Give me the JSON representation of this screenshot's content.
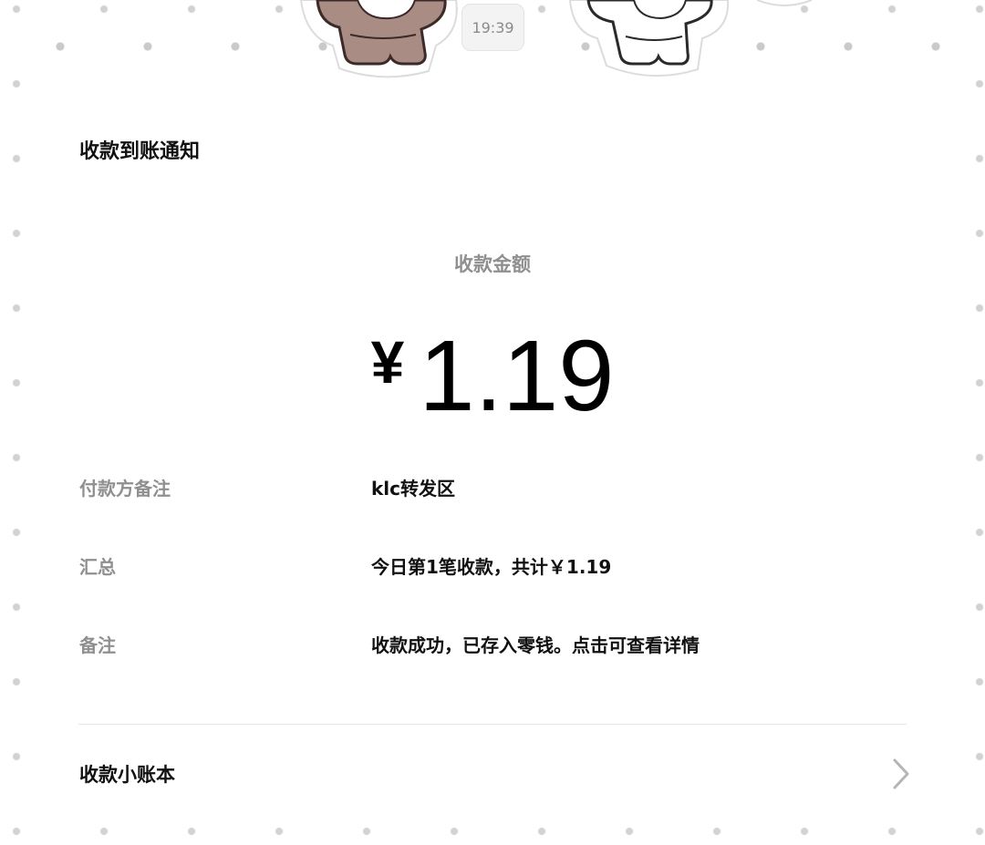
{
  "chat": {
    "timestamp": "19:39"
  },
  "notification": {
    "title": "收款到账通知",
    "amount_label": "收款金额",
    "currency_symbol": "¥",
    "amount": "1.19",
    "details": [
      {
        "key": "付款方备注",
        "value": "klc转发区"
      },
      {
        "key": "汇总",
        "value": "今日第1笔收款，共计￥1.19"
      },
      {
        "key": "备注",
        "value": "收款成功，已存入零钱。点击可查看详情"
      }
    ],
    "ledger_label": "收款小账本",
    "ledger_icon": "chevron-right-icon"
  },
  "colors": {
    "card_background": "#ffffff",
    "label_gray": "#8f8f8f",
    "text_black": "#111111",
    "divider": "#e6e6e6",
    "bear_brown": "#a98c84"
  }
}
